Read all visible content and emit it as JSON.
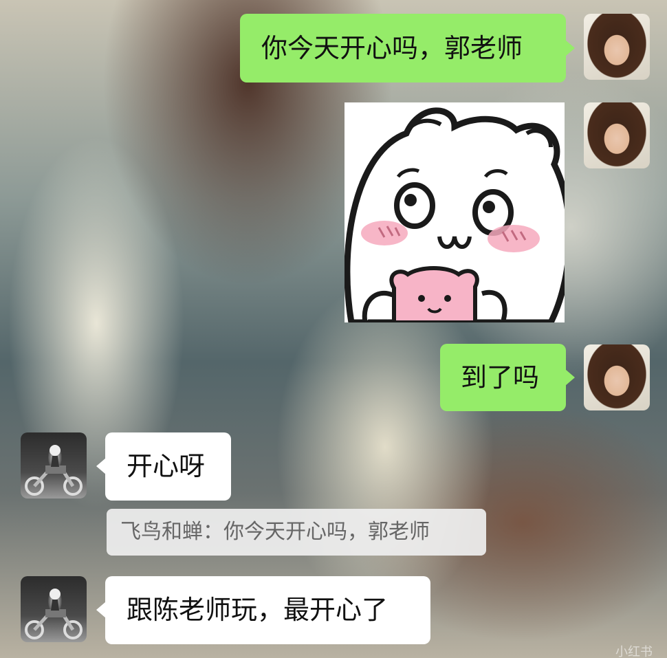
{
  "messages": [
    {
      "sender": "self",
      "text": "你今天开心吗，郭老师"
    },
    {
      "sender": "self",
      "sticker": "chiikawa-blushing-sticker"
    },
    {
      "sender": "self",
      "text": "到了吗"
    },
    {
      "sender": "other",
      "text": "开心呀"
    },
    {
      "sender": "other",
      "text": "跟陈老师玩，最开心了",
      "quote": {
        "author": "飞鸟和蝉",
        "text": "你今天开心吗，郭老师",
        "full": "飞鸟和蝉：你今天开心吗，郭老师"
      }
    }
  ],
  "colors": {
    "self_bubble": "#95ec69",
    "other_bubble": "#ffffff",
    "quote_bg": "#eeeeee"
  },
  "watermark": "小红书"
}
